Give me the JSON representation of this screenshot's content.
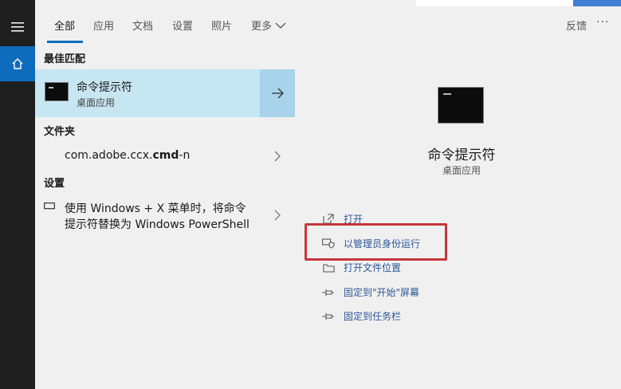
{
  "tabs": [
    {
      "label": "全部"
    },
    {
      "label": "应用"
    },
    {
      "label": "文档"
    },
    {
      "label": "设置"
    },
    {
      "label": "照片"
    },
    {
      "label": "更多"
    }
  ],
  "header": {
    "feedback_label": "反馈",
    "more_options": "···"
  },
  "sections": {
    "best_match": "最佳匹配",
    "folders": "文件夹",
    "settings": "设置"
  },
  "best_match": {
    "title": "命令提示符",
    "subtitle": "桌面应用"
  },
  "folder_item": {
    "prefix": "com.adobe.ccx.",
    "bold": "cmd",
    "suffix": "-n"
  },
  "settings_item": {
    "line1": "使用 Windows + X 菜单时，将命令",
    "line2": "提示符替换为 Windows PowerShell"
  },
  "preview": {
    "title": "命令提示符",
    "subtitle": "桌面应用"
  },
  "actions": [
    {
      "label": "打开",
      "icon": "open-icon"
    },
    {
      "label": "以管理员身份运行",
      "icon": "shield-icon"
    },
    {
      "label": "打开文件位置",
      "icon": "folder-icon"
    },
    {
      "label": "固定到\"开始\"屏幕",
      "icon": "pin-icon"
    },
    {
      "label": "固定到任务栏",
      "icon": "pin-icon"
    }
  ],
  "colors": {
    "accent": "#0f6cbd",
    "highlight_border": "#c4363a",
    "best_match_bg": "#c6e6f2",
    "action_text": "#2b5797"
  }
}
